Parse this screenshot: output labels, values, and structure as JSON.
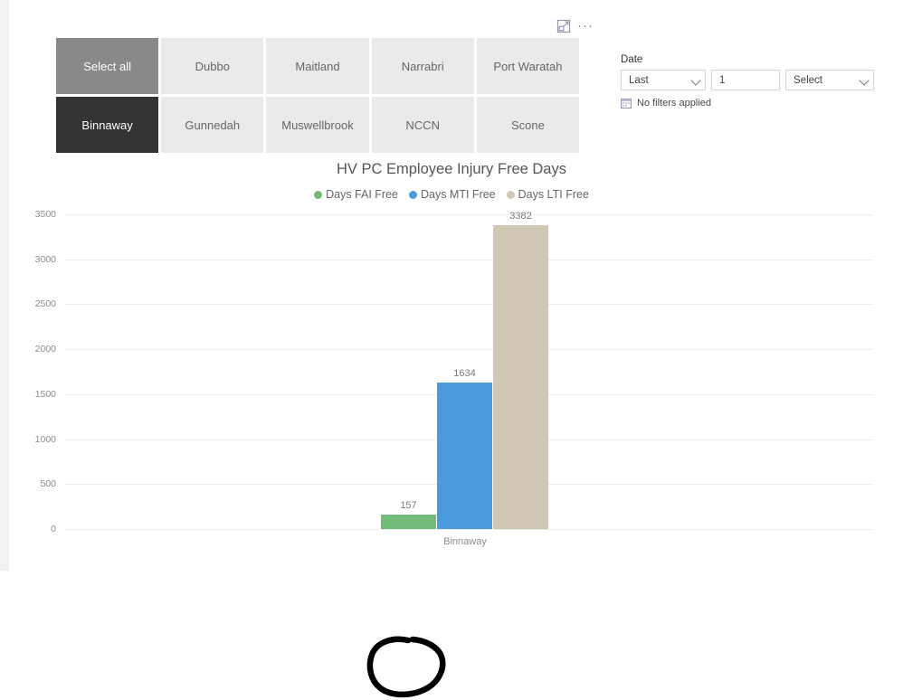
{
  "visual_header": {
    "focus_icon": "focus-mode-icon",
    "more_options_label": "···"
  },
  "slicer": {
    "name": "location-slicer",
    "tiles": [
      {
        "label": "Select all",
        "state": "select-all"
      },
      {
        "label": "Dubbo",
        "state": "unselected"
      },
      {
        "label": "Maitland",
        "state": "unselected"
      },
      {
        "label": "Narrabri",
        "state": "unselected"
      },
      {
        "label": "Port Waratah",
        "state": "unselected"
      },
      {
        "label": "Binnaway",
        "state": "selected"
      },
      {
        "label": "Gunnedah",
        "state": "unselected"
      },
      {
        "label": "Muswellbrook",
        "state": "unselected"
      },
      {
        "label": "NCCN",
        "state": "unselected"
      },
      {
        "label": "Scone",
        "state": "unselected"
      }
    ]
  },
  "date_filter": {
    "label": "Date",
    "operator_value": "Last",
    "count_value": "1",
    "unit_value": "Select",
    "status_text": "No filters applied",
    "status_icon": "calendar-icon"
  },
  "chart_data": {
    "type": "bar",
    "title": "HV PC Employee Injury Free Days",
    "xlabel": "",
    "ylabel": "",
    "categories": [
      "Binnaway"
    ],
    "ylim": [
      0,
      3500
    ],
    "yticks": [
      3500,
      3000,
      2500,
      2000,
      1500,
      1000,
      500,
      0
    ],
    "grid": true,
    "legend_position": "top-center",
    "series": [
      {
        "name": "Days FAI Free",
        "values": [
          157
        ],
        "color": "#71bc78"
      },
      {
        "name": "Days MTI Free",
        "values": [
          1634
        ],
        "color": "#4a9ade"
      },
      {
        "name": "Days LTI Free",
        "values": [
          3382
        ],
        "color": "#d0c8b4"
      }
    ]
  },
  "annotation": {
    "name": "hand-drawn-circle",
    "color": "#000000",
    "target": "Days FAI Free bar (157)"
  }
}
